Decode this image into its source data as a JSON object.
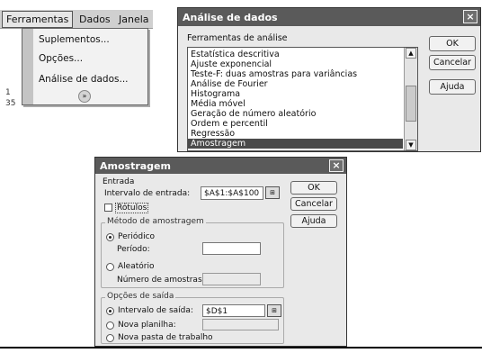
{
  "excel": {
    "menubar": {
      "items": [
        "Ferramentas",
        "Dados",
        "Janela"
      ]
    },
    "dropdown": {
      "items": [
        "Suplementos...",
        "Opções...",
        "Análise de dados..."
      ],
      "expand": "»"
    },
    "row_numbers": [
      "1",
      "35"
    ]
  },
  "analise_dialog": {
    "title": "Análise de dados",
    "close": "×",
    "list_label": "Ferramentas de análise",
    "tools": [
      "Estatística descritiva",
      "Ajuste exponencial",
      "Teste-F: duas amostras para variâncias",
      "Análise de Fourier",
      "Histograma",
      "Média móvel",
      "Geração de número aleatório",
      "Ordem e percentil",
      "Regressão",
      "Amostragem"
    ],
    "selected": "Amostragem",
    "buttons": {
      "ok": "OK",
      "cancel": "Cancelar",
      "help": "Ajuda"
    },
    "scroll_up": "▲",
    "scroll_down": "▼"
  },
  "amostragem_dialog": {
    "title": "Amostragem",
    "close": "×",
    "entrada": {
      "group_label": "Entrada",
      "range_label": "Intervalo de entrada:",
      "range_value": "$A$1:$A$100",
      "rotulos_label": "Rótulos",
      "rotulos_checked": false
    },
    "metodo": {
      "group_label": "Método de amostragem",
      "periodico_label": "Periódico",
      "periodo_label": "Período:",
      "periodo_value": "",
      "aleatorio_label": "Aleatório",
      "numero_label": "Número de amostras:",
      "numero_value": "",
      "selected": "Periódico"
    },
    "saida": {
      "group_label": "Opções de saída",
      "intervalo_label": "Intervalo de saída:",
      "intervalo_value": "$D$1",
      "nova_planilha_label": "Nova planilha:",
      "nova_planilha_value": "",
      "nova_pasta_label": "Nova pasta de trabalho",
      "selected": "Intervalo de saída:"
    },
    "buttons": {
      "ok": "OK",
      "cancel": "Cancelar",
      "help": "Ajuda"
    },
    "ref_icon": "⊞"
  }
}
